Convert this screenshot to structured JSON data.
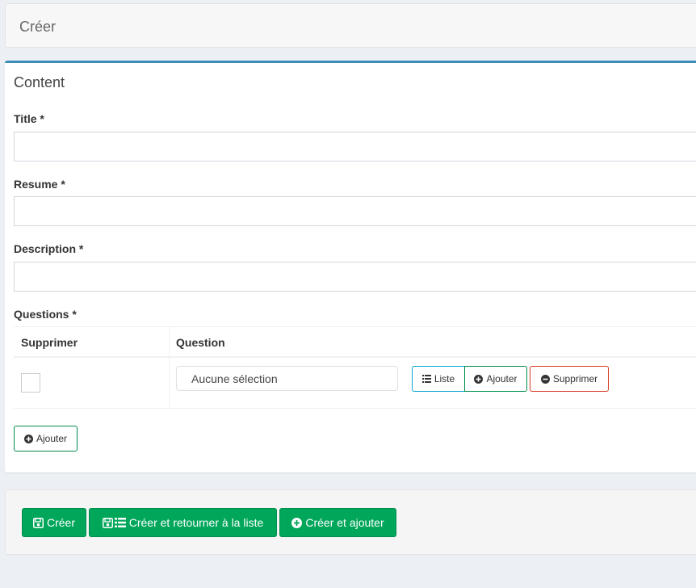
{
  "header": {
    "title": "Créer"
  },
  "content": {
    "title": "Content",
    "fields": {
      "title_label": "Title *",
      "resume_label": "Resume *",
      "description_label": "Description *",
      "questions_label": "Questions *"
    },
    "questions_table": {
      "col_delete": "Supprimer",
      "col_question": "Question",
      "rows": [
        {
          "selected": "Aucune sélection",
          "liste_label": "Liste",
          "ajouter_label": "Ajouter",
          "supprimer_label": "Supprimer"
        }
      ]
    },
    "add_button_label": "Ajouter"
  },
  "footer": {
    "create_label": "Créer",
    "create_return_label": "Créer et retourner à la liste",
    "create_add_label": "Créer et ajouter"
  },
  "icons": {
    "list": "list-icon",
    "plus": "plus-circle-icon",
    "minus": "minus-circle-icon",
    "save": "floppy-disk-icon"
  },
  "colors": {
    "box_accent": "#3c8dbc",
    "success": "#00a65a",
    "info": "#00a7d0",
    "danger": "#d73925"
  }
}
